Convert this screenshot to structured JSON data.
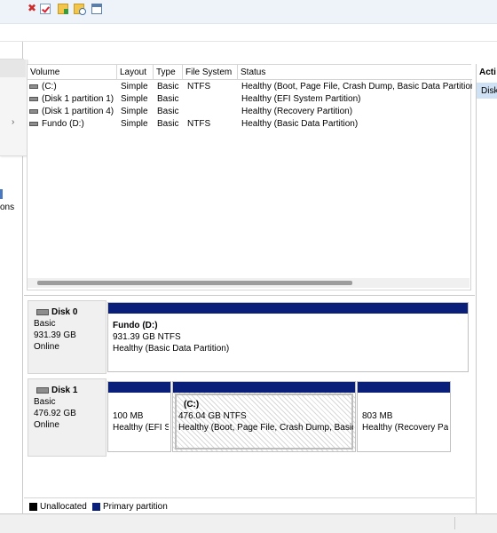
{
  "left_pane": {
    "truncated_text": "ons",
    "submenu_arrow": "›"
  },
  "toolbar": {
    "icons": [
      "delete-icon",
      "properties-check-icon",
      "folder-add-icon",
      "folder-open-icon",
      "window-icon"
    ]
  },
  "volume_list": {
    "columns": [
      "Volume",
      "Layout",
      "Type",
      "File System",
      "Status"
    ],
    "rows": [
      {
        "volume": "(C:)",
        "layout": "Simple",
        "type": "Basic",
        "fs": "NTFS",
        "status": "Healthy (Boot, Page File, Crash Dump, Basic Data Partition)"
      },
      {
        "volume": "(Disk 1 partition 1)",
        "layout": "Simple",
        "type": "Basic",
        "fs": "",
        "status": "Healthy (EFI System Partition)"
      },
      {
        "volume": "(Disk 1 partition 4)",
        "layout": "Simple",
        "type": "Basic",
        "fs": "",
        "status": "Healthy (Recovery Partition)"
      },
      {
        "volume": "Fundo (D:)",
        "layout": "Simple",
        "type": "Basic",
        "fs": "NTFS",
        "status": "Healthy (Basic Data Partition)"
      }
    ]
  },
  "actions": {
    "title": "Acti",
    "item": "Disk"
  },
  "disks": {
    "disk0": {
      "name": "Disk 0",
      "type": "Basic",
      "size": "931.39 GB",
      "state": "Online",
      "partitions": [
        {
          "name": "Fundo  (D:)",
          "size": "931.39 GB NTFS",
          "status": "Healthy (Basic Data Partition)"
        }
      ]
    },
    "disk1": {
      "name": "Disk 1",
      "type": "Basic",
      "size": "476.92 GB",
      "state": "Online",
      "partitions": [
        {
          "name": "",
          "size": "100 MB",
          "status": "Healthy (EFI S"
        },
        {
          "name": "(C:)",
          "size": "476.04 GB NTFS",
          "status": "Healthy (Boot, Page File, Crash Dump, Basic"
        },
        {
          "name": "",
          "size": "803 MB",
          "status": "Healthy (Recovery Pa"
        }
      ]
    }
  },
  "legend": [
    {
      "label": "Unallocated",
      "color": "#000000"
    },
    {
      "label": "Primary partition",
      "color": "#0a1f7a"
    }
  ]
}
